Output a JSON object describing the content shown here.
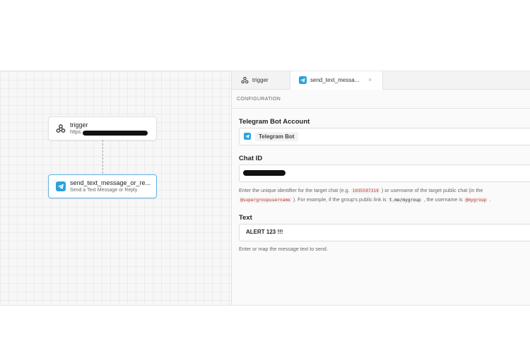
{
  "canvas": {
    "nodes": [
      {
        "title": "trigger",
        "subtitle": "https:",
        "icon": "webhook-icon"
      },
      {
        "title": "send_text_message_or_re...",
        "subtitle": "Send a Text Message or Reply",
        "icon": "telegram-icon"
      }
    ]
  },
  "tabs": [
    {
      "label": "trigger",
      "icon": "webhook-icon"
    },
    {
      "label": "send_text_messa...",
      "icon": "telegram-icon",
      "close": "×"
    }
  ],
  "panel": {
    "section": "CONFIGURATION",
    "bot_account_label": "Telegram Bot Account",
    "bot_account_value": "Telegram Bot",
    "chat_id_label": "Chat ID",
    "help1_a": "Enter the unique identifier for the target chat (e.g. ",
    "help1_code": "1035597319",
    "help1_b": " ) or username of the target public chat (in the",
    "help2_code1": "@supergroupusername",
    "help2_a": " ). For example, if the group's public link is ",
    "help2_code2": "t.me/mygroup",
    "help2_b": " , the username is ",
    "help2_code3": "@mygroup",
    "help2_c": " .",
    "text_label": "Text",
    "text_value": "ALERT 123 !!!",
    "text_help": "Enter or map the message text to send."
  },
  "colors": {
    "accent": "#5fb3e6",
    "telegram": "#2aa3df"
  }
}
